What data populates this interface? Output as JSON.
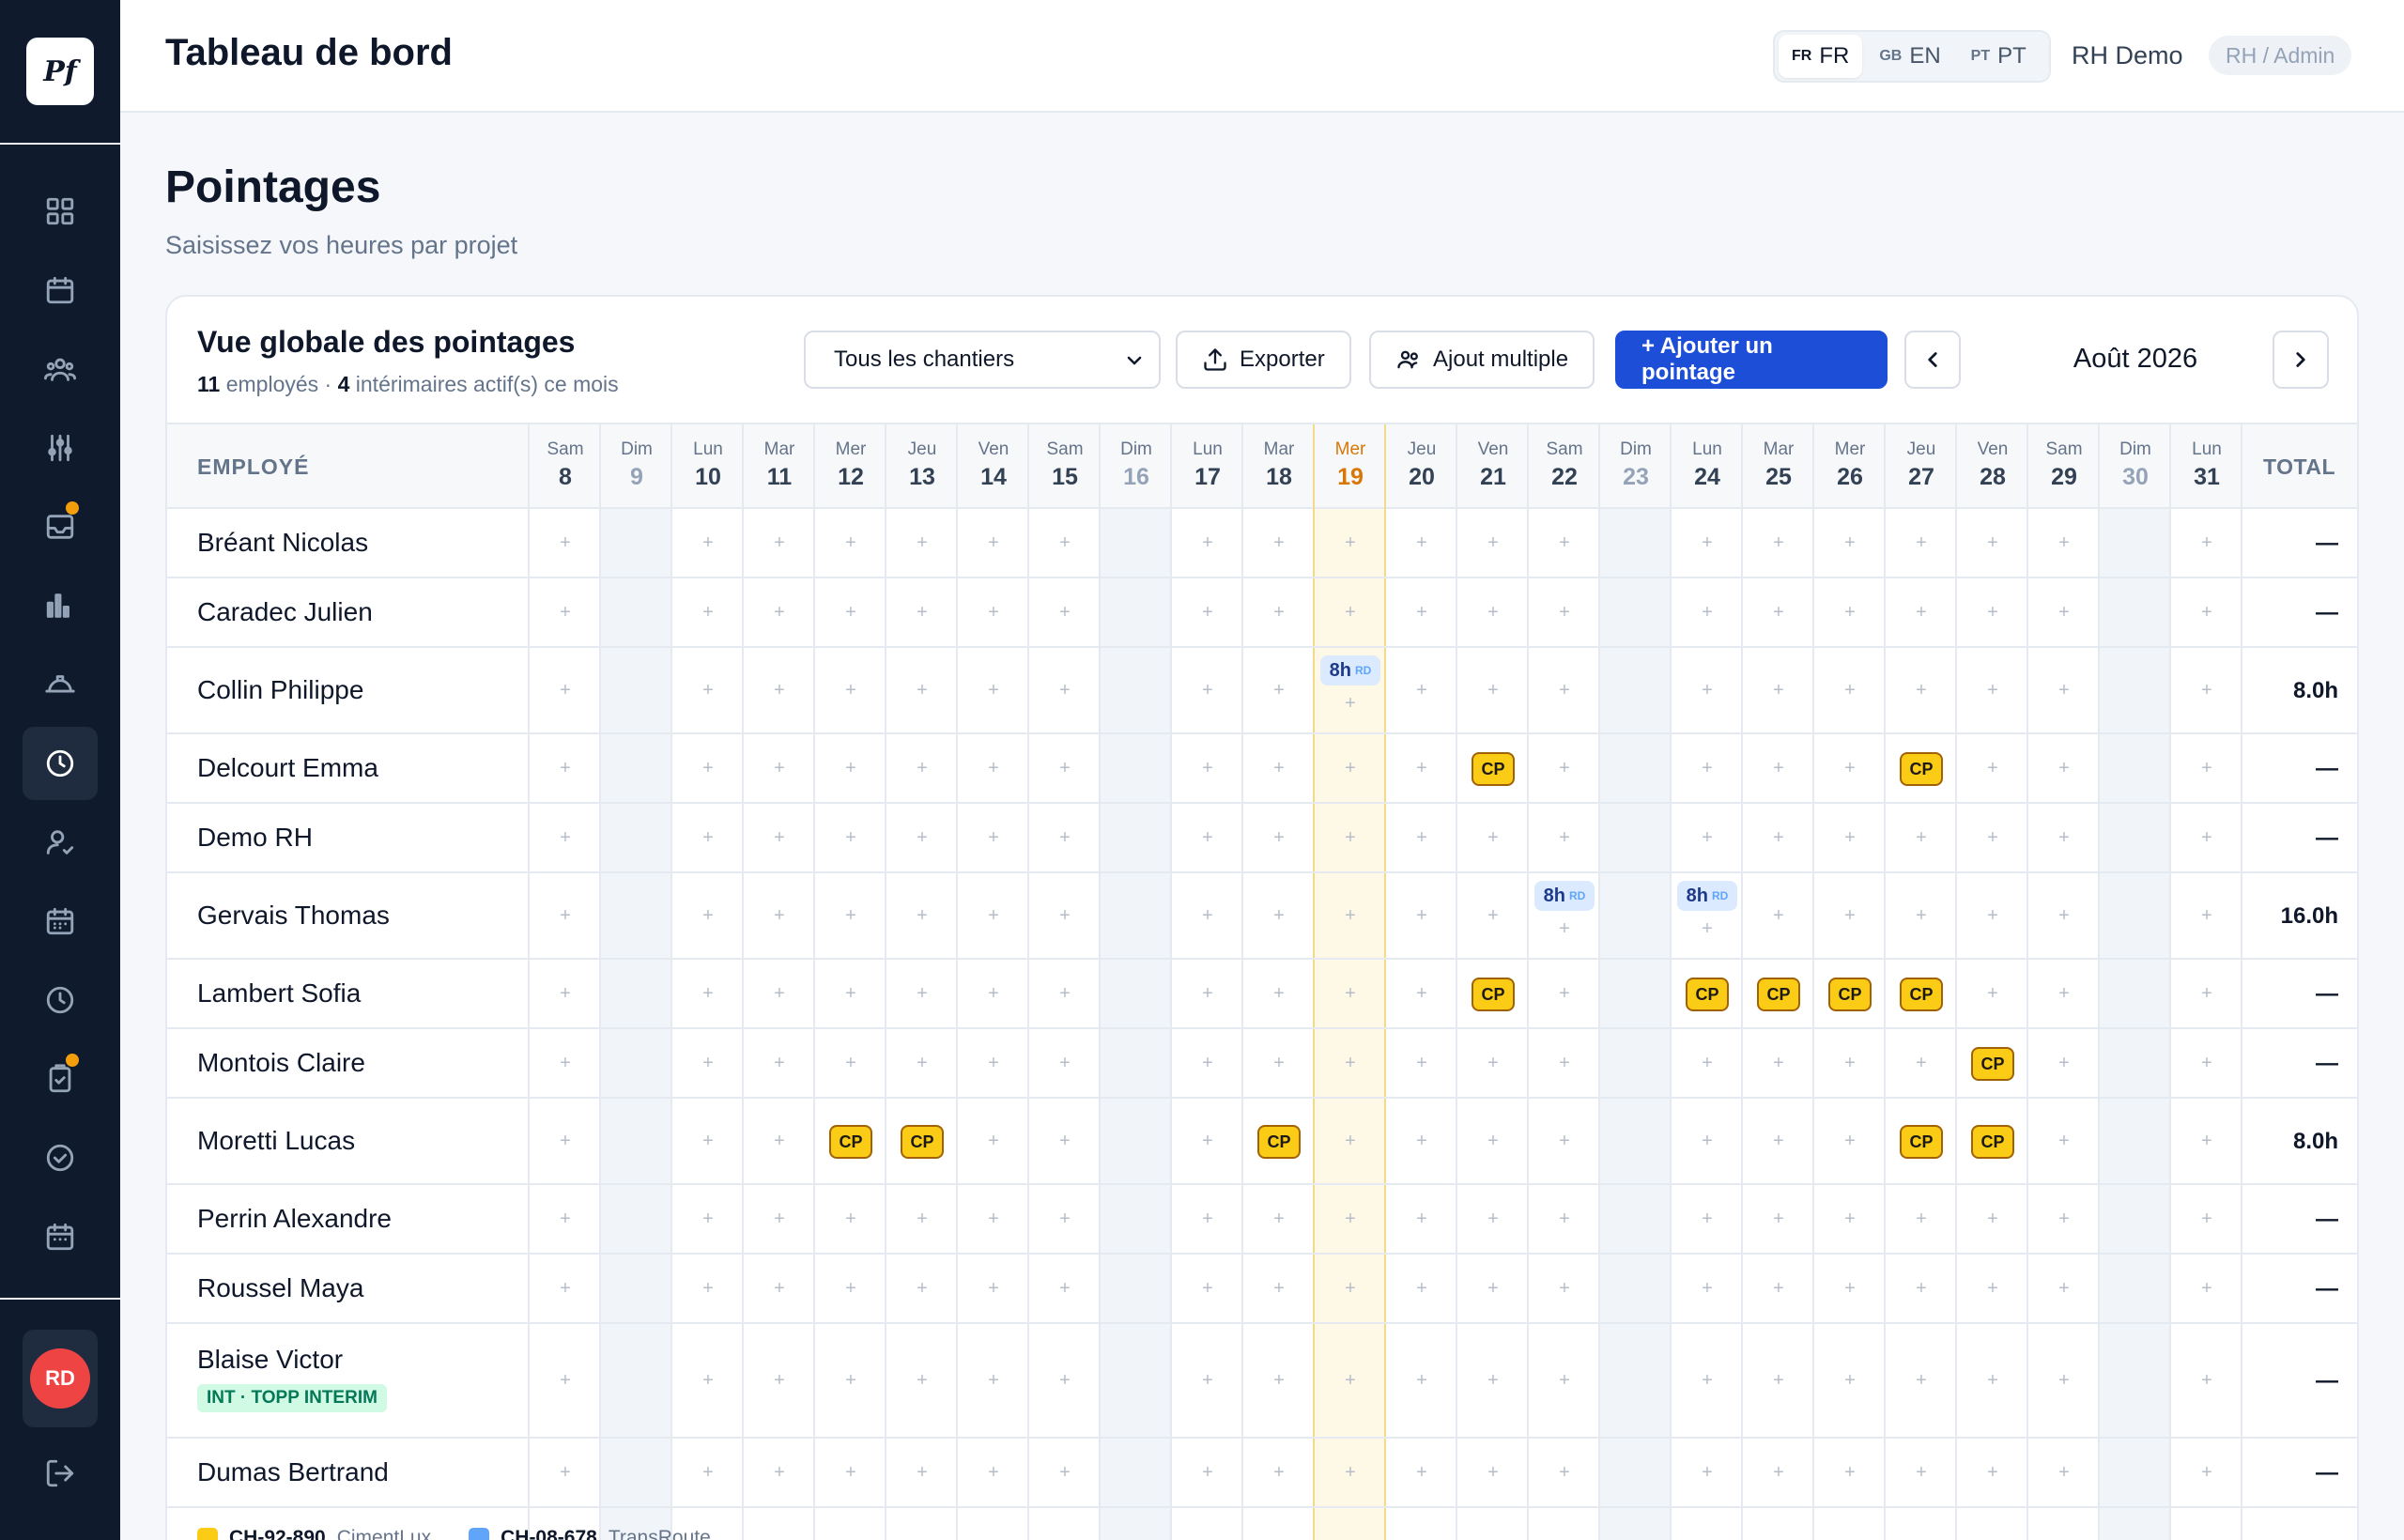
{
  "app": {
    "logo_text": "Pf",
    "header_title": "Tableau de bord",
    "user_name": "RH Demo",
    "role": "RH / Admin",
    "user_initials": "RD"
  },
  "languages": [
    {
      "code": "FR",
      "label": "FR",
      "active": true
    },
    {
      "code": "GB",
      "label": "EN",
      "active": false
    },
    {
      "code": "PT",
      "label": "PT",
      "active": false
    }
  ],
  "sidebar": {
    "items": [
      {
        "icon": "grid-icon",
        "label": "dashboard"
      },
      {
        "icon": "calendar-icon",
        "label": "calendar"
      },
      {
        "icon": "users-icon",
        "label": "teams"
      },
      {
        "icon": "sliders-icon",
        "label": "settings"
      },
      {
        "icon": "inbox-icon",
        "label": "inbox",
        "badge": true
      },
      {
        "icon": "bar-chart-icon",
        "label": "reports"
      },
      {
        "icon": "helmet-icon",
        "label": "sites"
      },
      {
        "icon": "clock-icon",
        "label": "pointages",
        "active": true
      },
      {
        "icon": "user-check-icon",
        "label": "staff"
      },
      {
        "icon": "calendar-grid-icon",
        "label": "planning"
      },
      {
        "icon": "history-icon",
        "label": "history"
      },
      {
        "icon": "clipboard-check-icon",
        "label": "tasks",
        "badge": true
      },
      {
        "icon": "check-circle-icon",
        "label": "validations"
      },
      {
        "icon": "calendar-dots-icon",
        "label": "absences"
      }
    ],
    "logout_icon": "logout-icon"
  },
  "page": {
    "title": "Pointages",
    "subtitle": "Saisissez vos heures par projet"
  },
  "card": {
    "title": "Vue globale des pointages",
    "employees_count": "11",
    "employees_text": "employés · ",
    "temps_count": "4",
    "temps_text": "intérimaires actif(s) ce mois",
    "filter_value": "Tous les chantiers",
    "export_label": "Exporter",
    "bulk_label": "Ajout multiple",
    "add_label": "+ Ajouter un pointage",
    "month_label": "Août 2026"
  },
  "table": {
    "employee_header": "EMPLOYÉ",
    "total_header": "TOTAL",
    "days": [
      {
        "name": "Sam",
        "num": "8",
        "weekend": false
      },
      {
        "name": "Dim",
        "num": "9",
        "weekend": true
      },
      {
        "name": "Lun",
        "num": "10",
        "weekend": false
      },
      {
        "name": "Mar",
        "num": "11",
        "weekend": false
      },
      {
        "name": "Mer",
        "num": "12",
        "weekend": false
      },
      {
        "name": "Jeu",
        "num": "13",
        "weekend": false
      },
      {
        "name": "Ven",
        "num": "14",
        "weekend": false
      },
      {
        "name": "Sam",
        "num": "15",
        "weekend": false
      },
      {
        "name": "Dim",
        "num": "16",
        "weekend": true
      },
      {
        "name": "Lun",
        "num": "17",
        "weekend": false
      },
      {
        "name": "Mar",
        "num": "18",
        "weekend": false
      },
      {
        "name": "Mer",
        "num": "19",
        "weekend": false,
        "today": true
      },
      {
        "name": "Jeu",
        "num": "20",
        "weekend": false
      },
      {
        "name": "Ven",
        "num": "21",
        "weekend": false
      },
      {
        "name": "Sam",
        "num": "22",
        "weekend": false
      },
      {
        "name": "Dim",
        "num": "23",
        "weekend": true
      },
      {
        "name": "Lun",
        "num": "24",
        "weekend": false
      },
      {
        "name": "Mar",
        "num": "25",
        "weekend": false
      },
      {
        "name": "Mer",
        "num": "26",
        "weekend": false
      },
      {
        "name": "Jeu",
        "num": "27",
        "weekend": false
      },
      {
        "name": "Ven",
        "num": "28",
        "weekend": false
      },
      {
        "name": "Sam",
        "num": "29",
        "weekend": false
      },
      {
        "name": "Dim",
        "num": "30",
        "weekend": true
      },
      {
        "name": "Lun",
        "num": "31",
        "weekend": false
      }
    ],
    "rows": [
      {
        "name": "Bréant Nicolas",
        "total": "—",
        "cells": {}
      },
      {
        "name": "Caradec Julien",
        "total": "—",
        "cells": {}
      },
      {
        "name": "Collin Philippe",
        "total": "8.0h",
        "cells": {
          "11": {
            "type": "hours",
            "value": "8h",
            "tag": "RD"
          }
        }
      },
      {
        "name": "Delcourt Emma",
        "total": "—",
        "cells": {
          "13": {
            "type": "cp",
            "value": "CP"
          },
          "19": {
            "type": "cp",
            "value": "CP"
          }
        }
      },
      {
        "name": "Demo RH",
        "total": "—",
        "cells": {}
      },
      {
        "name": "Gervais Thomas",
        "total": "16.0h",
        "cells": {
          "14": {
            "type": "hours",
            "value": "8h",
            "tag": "RD"
          },
          "16": {
            "type": "hours",
            "value": "8h",
            "tag": "RD"
          }
        }
      },
      {
        "name": "Lambert Sofia",
        "total": "—",
        "cells": {
          "13": {
            "type": "cp",
            "value": "CP"
          },
          "16": {
            "type": "cp",
            "value": "CP"
          },
          "17": {
            "type": "cp",
            "value": "CP"
          },
          "18": {
            "type": "cp",
            "value": "CP"
          },
          "19": {
            "type": "cp",
            "value": "CP"
          }
        }
      },
      {
        "name": "Montois Claire",
        "total": "—",
        "cells": {
          "20": {
            "type": "cp",
            "value": "CP"
          }
        }
      },
      {
        "name": "Moretti Lucas",
        "total": "8.0h",
        "cells": {
          "4": {
            "type": "cp",
            "value": "CP"
          },
          "5": {
            "type": "cp",
            "value": "CP"
          },
          "10": {
            "type": "cp",
            "value": "CP"
          },
          "19": {
            "type": "cp",
            "value": "CP"
          },
          "20": {
            "type": "cp",
            "value": "CP"
          }
        }
      },
      {
        "name": "Perrin Alexandre",
        "total": "—",
        "cells": {}
      },
      {
        "name": "Roussel Maya",
        "total": "—",
        "cells": {}
      },
      {
        "name": "Blaise Victor",
        "total": "—",
        "badge": "INT · TOPP INTERIM",
        "cells": {}
      },
      {
        "name": "Dumas Bertrand",
        "total": "—",
        "cells": {}
      }
    ]
  },
  "legend": [
    {
      "code": "CH-92-890",
      "name": "CimentLux",
      "color": "#facc15"
    },
    {
      "code": "CH-08-678",
      "name": "TransRoute",
      "color": "#60a5fa"
    }
  ],
  "colors": {
    "primary": "#1d4ed8",
    "sidebar_bg": "#0f1b2d",
    "cp_badge": "#facc15",
    "hours_badge": "#dbeafe",
    "today": "#fef9e7",
    "weekend": "#f1f4f8",
    "notification_dot": "#f59e0b",
    "avatar": "#ef4444",
    "interim_badge": "#d1fae5"
  }
}
